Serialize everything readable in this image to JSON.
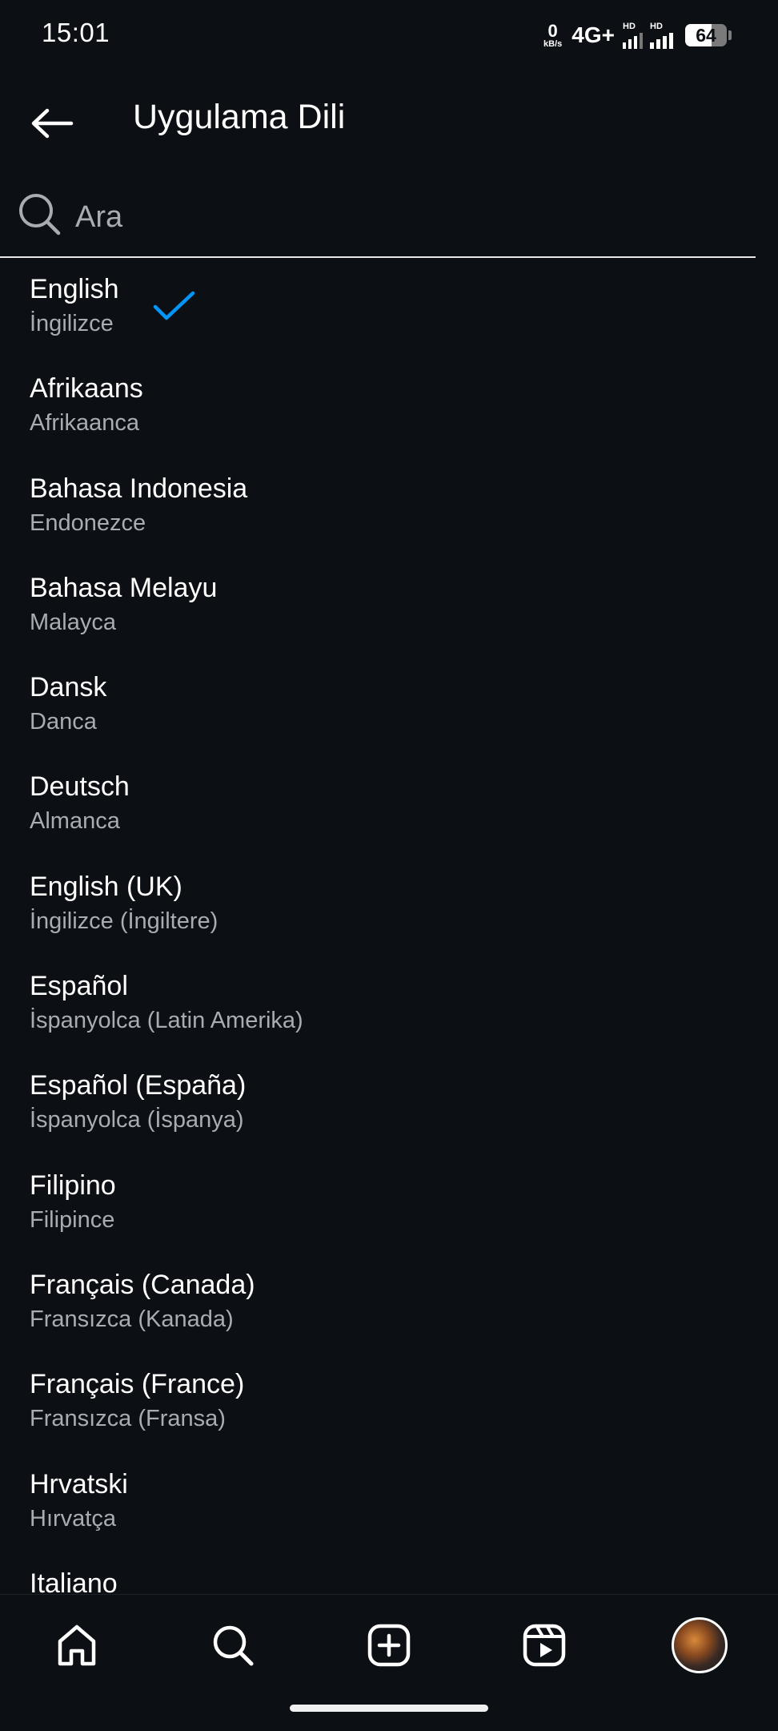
{
  "status_bar": {
    "time": "15:01",
    "net_speed_value": "0",
    "net_speed_unit": "kB/s",
    "network_type": "4G+",
    "sim1_label": "HD",
    "sim2_label": "HD",
    "battery_level": "64",
    "battery_fraction": 0.64
  },
  "header": {
    "title": "Uygulama Dili",
    "back_icon": "arrow-left-icon"
  },
  "search": {
    "placeholder": "Ara",
    "value": ""
  },
  "languages": [
    {
      "name": "English",
      "local": "İngilizce",
      "selected": true
    },
    {
      "name": "Afrikaans",
      "local": "Afrikaanca",
      "selected": false
    },
    {
      "name": "Bahasa Indonesia",
      "local": "Endonezce",
      "selected": false
    },
    {
      "name": "Bahasa Melayu",
      "local": "Malayca",
      "selected": false
    },
    {
      "name": "Dansk",
      "local": "Danca",
      "selected": false
    },
    {
      "name": "Deutsch",
      "local": "Almanca",
      "selected": false
    },
    {
      "name": "English (UK)",
      "local": "İngilizce (İngiltere)",
      "selected": false
    },
    {
      "name": "Español",
      "local": "İspanyolca (Latin Amerika)",
      "selected": false
    },
    {
      "name": "Español (España)",
      "local": "İspanyolca (İspanya)",
      "selected": false
    },
    {
      "name": "Filipino",
      "local": "Filipince",
      "selected": false
    },
    {
      "name": "Français (Canada)",
      "local": "Fransızca (Kanada)",
      "selected": false
    },
    {
      "name": "Français (France)",
      "local": "Fransızca (Fransa)",
      "selected": false
    },
    {
      "name": "Hrvatski",
      "local": "Hırvatça",
      "selected": false
    },
    {
      "name": "Italiano",
      "local": "",
      "selected": false
    }
  ],
  "bottom_nav": {
    "items": [
      {
        "id": "home",
        "icon": "home-icon"
      },
      {
        "id": "search",
        "icon": "search-icon"
      },
      {
        "id": "create",
        "icon": "plus-square-icon"
      },
      {
        "id": "reels",
        "icon": "reels-icon"
      },
      {
        "id": "profile",
        "icon": "avatar"
      }
    ]
  },
  "colors": {
    "background": "#0c0f14",
    "primary_text": "#ffffff",
    "secondary_text": "#a8acb3",
    "check_accent": "#0095f6"
  }
}
